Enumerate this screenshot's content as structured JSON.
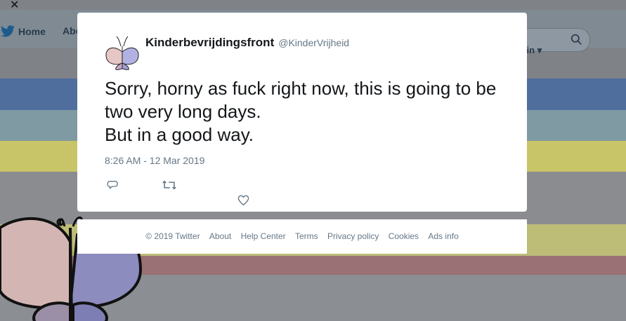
{
  "background": {
    "nav": {
      "home_label": "Home",
      "about_label": "Abo",
      "login_label": "g in"
    },
    "bands": [
      "#4f6e9e",
      "#7f9aa3",
      "#c8c468",
      "#cfcf7a",
      "#9a7174"
    ]
  },
  "modal": {
    "author": {
      "name": "Kinderbevrijdingsfront",
      "handle": "@KinderVrijheid"
    },
    "tweet_text": "Sorry, horny as fuck right now, this is going to be two very long days.\nBut in a good way.",
    "timestamp": "8:26 AM - 12 Mar 2019",
    "icons": {
      "reply": "reply-icon",
      "retweet": "retweet-icon",
      "like": "heart-icon"
    }
  },
  "footer": {
    "copyright": "© 2019 Twitter",
    "links": [
      "About",
      "Help Center",
      "Terms",
      "Privacy policy",
      "Cookies",
      "Ads info"
    ]
  },
  "close_icon": "close-icon"
}
